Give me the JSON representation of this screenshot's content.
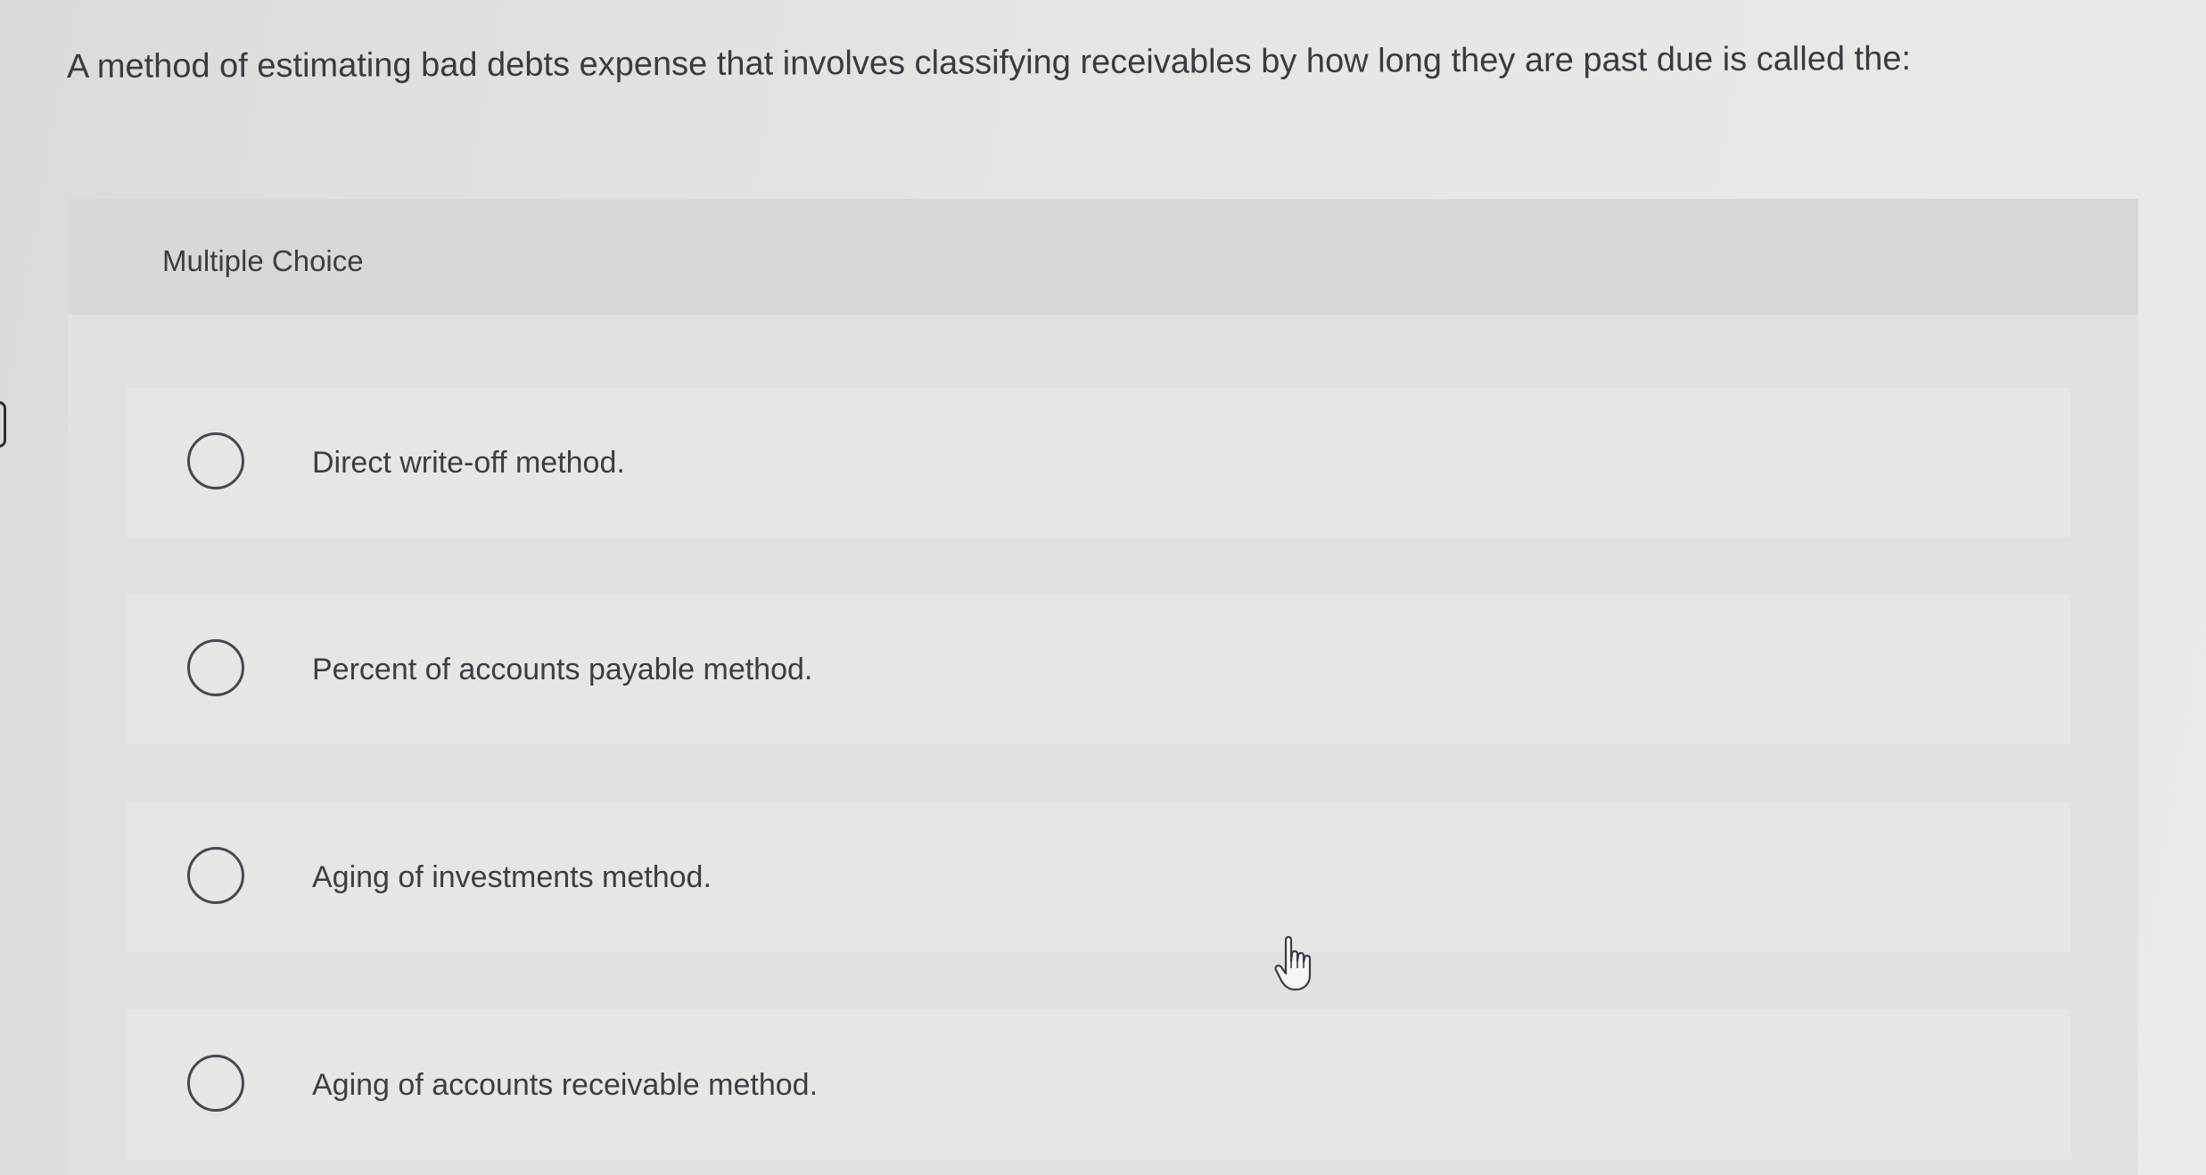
{
  "question": {
    "text": "A method of estimating bad debts expense that involves classifying receivables by how long they are past due is called the:"
  },
  "multiple_choice": {
    "title": "Multiple Choice",
    "options": [
      {
        "label": "Direct write-off method."
      },
      {
        "label": "Percent of accounts payable method."
      },
      {
        "label": "Aging of investments method."
      },
      {
        "label": "Aging of accounts receivable method."
      }
    ]
  },
  "icons": {
    "radio": "radio-unselected-icon",
    "cursor": "hand-pointer-cursor-icon"
  }
}
